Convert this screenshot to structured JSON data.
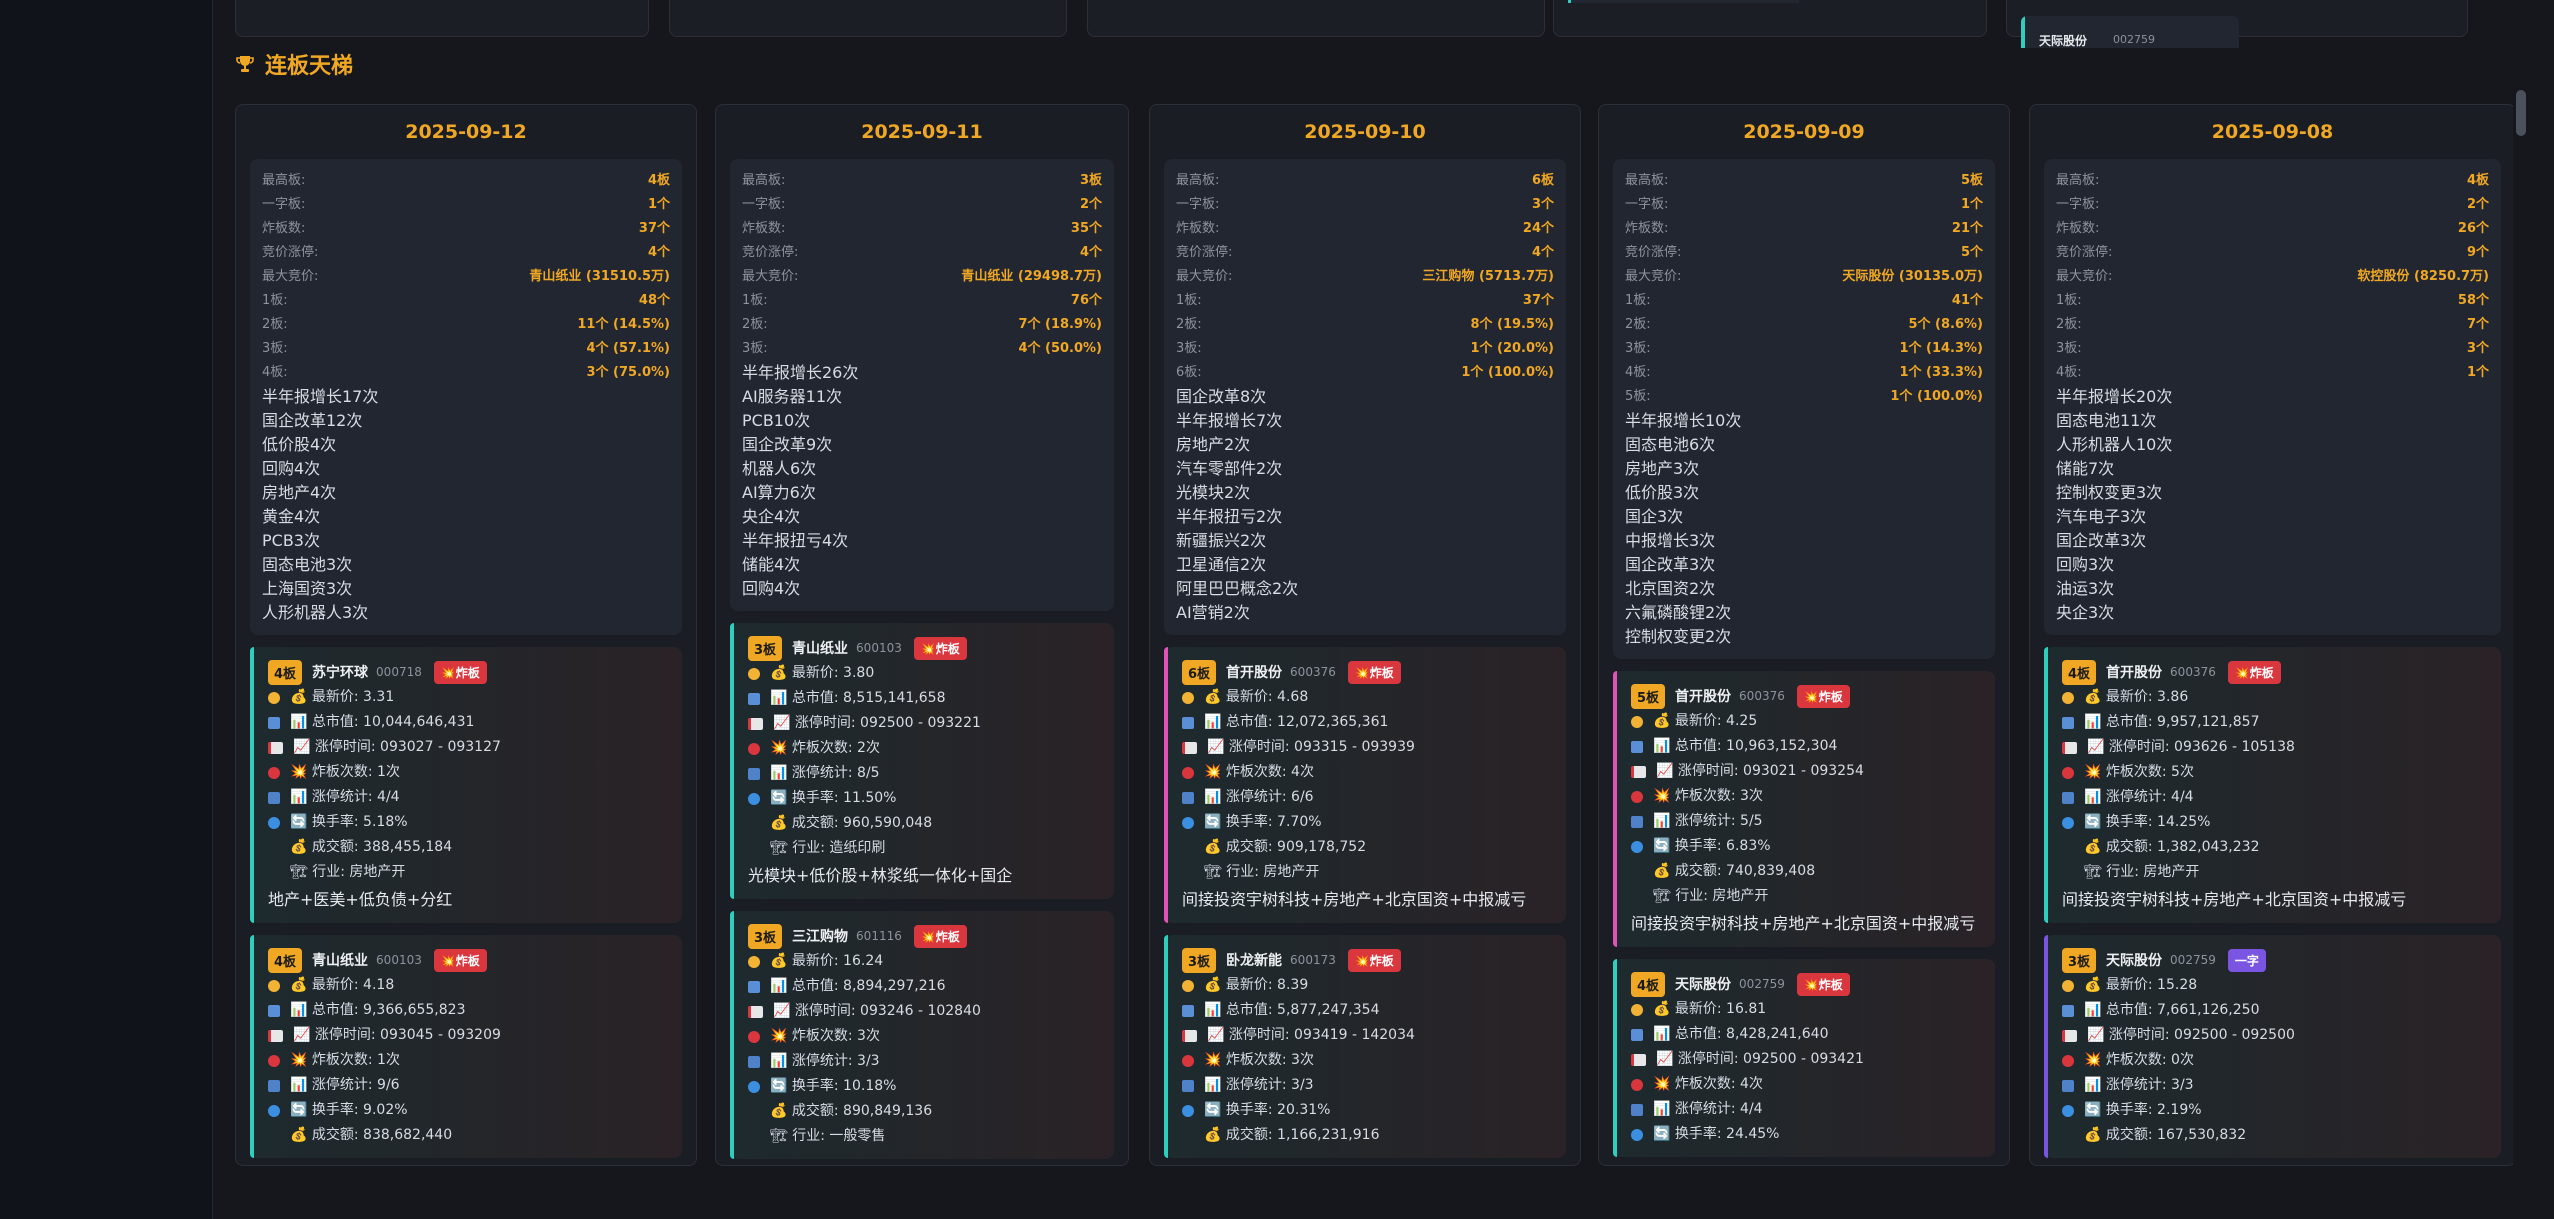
{
  "section_title": "连板天梯",
  "top_mini_card": {
    "name": "天际股份",
    "code": "002759"
  },
  "columns": [
    {
      "date": "2025-09-12",
      "stats": [
        {
          "k": "最高板:",
          "v": "4板"
        },
        {
          "k": "一字板:",
          "v": "1个"
        },
        {
          "k": "炸板数:",
          "v": "37个"
        },
        {
          "k": "竞价涨停:",
          "v": "4个"
        },
        {
          "k": "最大竞价:",
          "v": "青山纸业 (31510.5万)"
        },
        {
          "k": "1板:",
          "v": "48个"
        },
        {
          "k": "2板:",
          "v": "11个 (14.5%)"
        },
        {
          "k": "3板:",
          "v": "4个 (57.1%)"
        },
        {
          "k": "4板:",
          "v": "3个 (75.0%)"
        }
      ],
      "concepts": [
        "半年报增长17次",
        "国企改革12次",
        "低价股4次",
        "回购4次",
        "房地产4次",
        "黄金4次",
        "PCB3次",
        "固态电池3次",
        "上海国资3次",
        "人形机器人3次"
      ],
      "stocks": [
        {
          "badge": "4板",
          "name": "苏宁环球",
          "code": "000718",
          "tag": "💥炸板",
          "tag_type": "zha",
          "bar_color": "#2ecfbf",
          "price": "💰 最新价: 3.31",
          "cap": "📊 总市值: 10,044,646,431",
          "time": "📈 涨停时间: 093027 - 093127",
          "boom": "💥 炸板次数: 1次",
          "count": "📊 涨停统计: 4/4",
          "turn": "🔄 换手率: 5.18%",
          "amount": "💰 成交额: 388,455,184",
          "industry": "🏗 行业: 房地产开",
          "reason": "地产+医美+低负债+分红"
        },
        {
          "badge": "4板",
          "name": "青山纸业",
          "code": "600103",
          "tag": "💥炸板",
          "tag_type": "zha",
          "bar_color": "#2ecfbf",
          "price": "💰 最新价: 4.18",
          "cap": "📊 总市值: 9,366,655,823",
          "time": "📈 涨停时间: 093045 - 093209",
          "boom": "💥 炸板次数: 1次",
          "count": "📊 涨停统计: 9/6",
          "turn": "🔄 换手率: 9.02%",
          "amount": "💰 成交额: 838,682,440",
          "industry": "",
          "reason": ""
        }
      ]
    },
    {
      "date": "2025-09-11",
      "stats": [
        {
          "k": "最高板:",
          "v": "3板"
        },
        {
          "k": "一字板:",
          "v": "2个"
        },
        {
          "k": "炸板数:",
          "v": "35个"
        },
        {
          "k": "竞价涨停:",
          "v": "4个"
        },
        {
          "k": "最大竞价:",
          "v": "青山纸业 (29498.7万)"
        },
        {
          "k": "1板:",
          "v": "76个"
        },
        {
          "k": "2板:",
          "v": "7个 (18.9%)"
        },
        {
          "k": "3板:",
          "v": "4个 (50.0%)"
        }
      ],
      "concepts": [
        "半年报增长26次",
        "AI服务器11次",
        "PCB10次",
        "国企改革9次",
        "机器人6次",
        "AI算力6次",
        "央企4次",
        "半年报扭亏4次",
        "储能4次",
        "回购4次"
      ],
      "stocks": [
        {
          "badge": "3板",
          "name": "青山纸业",
          "code": "600103",
          "tag": "💥炸板",
          "tag_type": "zha",
          "bar_color": "#2ecfbf",
          "price": "💰 最新价: 3.80",
          "cap": "📊 总市值: 8,515,141,658",
          "time": "📈 涨停时间: 092500 - 093221",
          "boom": "💥 炸板次数: 2次",
          "count": "📊 涨停统计: 8/5",
          "turn": "🔄 换手率: 11.50%",
          "amount": "💰 成交额: 960,590,048",
          "industry": "🏗 行业: 造纸印刷",
          "reason": "光模块+低价股+林浆纸一体化+国企"
        },
        {
          "badge": "3板",
          "name": "三江购物",
          "code": "601116",
          "tag": "💥炸板",
          "tag_type": "zha",
          "bar_color": "#2ecfbf",
          "price": "💰 最新价: 16.24",
          "cap": "📊 总市值: 8,894,297,216",
          "time": "📈 涨停时间: 093246 - 102840",
          "boom": "💥 炸板次数: 3次",
          "count": "📊 涨停统计: 3/3",
          "turn": "🔄 换手率: 10.18%",
          "amount": "💰 成交额: 890,849,136",
          "industry": "🏗 行业: 一般零售",
          "reason": ""
        }
      ]
    },
    {
      "date": "2025-09-10",
      "stats": [
        {
          "k": "最高板:",
          "v": "6板"
        },
        {
          "k": "一字板:",
          "v": "3个"
        },
        {
          "k": "炸板数:",
          "v": "24个"
        },
        {
          "k": "竞价涨停:",
          "v": "4个"
        },
        {
          "k": "最大竞价:",
          "v": "三江购物 (5713.7万)"
        },
        {
          "k": "1板:",
          "v": "37个"
        },
        {
          "k": "2板:",
          "v": "8个 (19.5%)"
        },
        {
          "k": "3板:",
          "v": "1个 (20.0%)"
        },
        {
          "k": "6板:",
          "v": "1个 (100.0%)"
        }
      ],
      "concepts": [
        "国企改革8次",
        "半年报增长7次",
        "房地产2次",
        "汽车零部件2次",
        "光模块2次",
        "半年报扭亏2次",
        "新疆振兴2次",
        "卫星通信2次",
        "阿里巴巴概念2次",
        "AI营销2次"
      ],
      "stocks": [
        {
          "badge": "6板",
          "name": "首开股份",
          "code": "600376",
          "tag": "💥炸板",
          "tag_type": "zha",
          "bar_color": "#e052b8",
          "price": "💰 最新价: 4.68",
          "cap": "📊 总市值: 12,072,365,361",
          "time": "📈 涨停时间: 093315 - 093939",
          "boom": "💥 炸板次数: 4次",
          "count": "📊 涨停统计: 6/6",
          "turn": "🔄 换手率: 7.70%",
          "amount": "💰 成交额: 909,178,752",
          "industry": "🏗 行业: 房地产开",
          "reason": "间接投资宇树科技+房地产+北京国资+中报减亏"
        },
        {
          "badge": "3板",
          "name": "卧龙新能",
          "code": "600173",
          "tag": "💥炸板",
          "tag_type": "zha",
          "bar_color": "#2ecfbf",
          "price": "💰 最新价: 8.39",
          "cap": "📊 总市值: 5,877,247,354",
          "time": "📈 涨停时间: 093419 - 142034",
          "boom": "💥 炸板次数: 3次",
          "count": "📊 涨停统计: 3/3",
          "turn": "🔄 换手率: 20.31%",
          "amount": "💰 成交额: 1,166,231,916",
          "industry": "",
          "reason": ""
        }
      ]
    },
    {
      "date": "2025-09-09",
      "stats": [
        {
          "k": "最高板:",
          "v": "5板"
        },
        {
          "k": "一字板:",
          "v": "1个"
        },
        {
          "k": "炸板数:",
          "v": "21个"
        },
        {
          "k": "竞价涨停:",
          "v": "5个"
        },
        {
          "k": "最大竞价:",
          "v": "天际股份 (30135.0万)"
        },
        {
          "k": "1板:",
          "v": "41个"
        },
        {
          "k": "2板:",
          "v": "5个 (8.6%)"
        },
        {
          "k": "3板:",
          "v": "1个 (14.3%)"
        },
        {
          "k": "4板:",
          "v": "1个 (33.3%)"
        },
        {
          "k": "5板:",
          "v": "1个 (100.0%)"
        }
      ],
      "concepts": [
        "半年报增长10次",
        "固态电池6次",
        "房地产3次",
        "低价股3次",
        "国企3次",
        "中报增长3次",
        "国企改革3次",
        "北京国资2次",
        "六氟磷酸锂2次",
        "控制权变更2次"
      ],
      "stocks": [
        {
          "badge": "5板",
          "name": "首开股份",
          "code": "600376",
          "tag": "💥炸板",
          "tag_type": "zha",
          "bar_color": "#e052b8",
          "price": "💰 最新价: 4.25",
          "cap": "📊 总市值: 10,963,152,304",
          "time": "📈 涨停时间: 093021 - 093254",
          "boom": "💥 炸板次数: 3次",
          "count": "📊 涨停统计: 5/5",
          "turn": "🔄 换手率: 6.83%",
          "amount": "💰 成交额: 740,839,408",
          "industry": "🏗 行业: 房地产开",
          "reason": "间接投资宇树科技+房地产+北京国资+中报减亏"
        },
        {
          "badge": "4板",
          "name": "天际股份",
          "code": "002759",
          "tag": "💥炸板",
          "tag_type": "zha",
          "bar_color": "#2ecfbf",
          "price": "💰 最新价: 16.81",
          "cap": "📊 总市值: 8,428,241,640",
          "time": "📈 涨停时间: 092500 - 093421",
          "boom": "💥 炸板次数: 4次",
          "count": "📊 涨停统计: 4/4",
          "turn": "🔄 换手率: 24.45%",
          "amount": "",
          "industry": "",
          "reason": ""
        }
      ]
    },
    {
      "date": "2025-09-08",
      "stats": [
        {
          "k": "最高板:",
          "v": "4板"
        },
        {
          "k": "一字板:",
          "v": "2个"
        },
        {
          "k": "炸板数:",
          "v": "26个"
        },
        {
          "k": "竞价涨停:",
          "v": "9个"
        },
        {
          "k": "最大竞价:",
          "v": "软控股份 (8250.7万)"
        },
        {
          "k": "1板:",
          "v": "58个"
        },
        {
          "k": "2板:",
          "v": "7个"
        },
        {
          "k": "3板:",
          "v": "3个"
        },
        {
          "k": "4板:",
          "v": "1个"
        }
      ],
      "concepts": [
        "半年报增长20次",
        "固态电池11次",
        "人形机器人10次",
        "储能7次",
        "控制权变更3次",
        "汽车电子3次",
        "国企改革3次",
        "回购3次",
        "油运3次",
        "央企3次"
      ],
      "stocks": [
        {
          "badge": "4板",
          "name": "首开股份",
          "code": "600376",
          "tag": "💥炸板",
          "tag_type": "zha",
          "bar_color": "#2ecfbf",
          "price": "💰 最新价: 3.86",
          "cap": "📊 总市值: 9,957,121,857",
          "time": "📈 涨停时间: 093626 - 105138",
          "boom": "💥 炸板次数: 5次",
          "count": "📊 涨停统计: 4/4",
          "turn": "🔄 换手率: 14.25%",
          "amount": "💰 成交额: 1,382,043,232",
          "industry": "🏗 行业: 房地产开",
          "reason": "间接投资宇树科技+房地产+北京国资+中报减亏"
        },
        {
          "badge": "3板",
          "name": "天际股份",
          "code": "002759",
          "tag": "一字",
          "tag_type": "yz",
          "bar_color": "#7a55e2",
          "price": "💰 最新价: 15.28",
          "cap": "📊 总市值: 7,661,126,250",
          "time": "📈 涨停时间: 092500 - 092500",
          "boom": "💥 炸板次数: 0次",
          "count": "📊 涨停统计: 3/3",
          "turn": "🔄 换手率: 2.19%",
          "amount": "💰 成交额: 167,530,832",
          "industry": "",
          "reason": ""
        }
      ]
    }
  ]
}
